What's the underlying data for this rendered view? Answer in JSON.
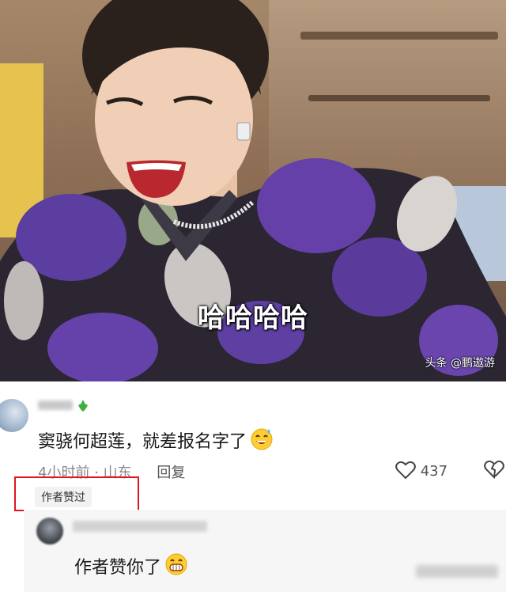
{
  "video": {
    "caption": "哈哈哈哈",
    "watermark": "头条 @鹏遨游"
  },
  "comment": {
    "text": "窦骁何超莲，就差报名字了",
    "emoji": "laughing-sweat-emoji",
    "time": "4小时前",
    "separator": "·",
    "location": "山东",
    "reply_label": "回复",
    "like_count": "437",
    "author_liked_tag": "作者赞过"
  },
  "reply": {
    "text": "作者赞你了",
    "emoji": "grinning-emoji"
  },
  "colors": {
    "highlight_box": "#e0161d",
    "leaf_badge": "#3fae3f"
  }
}
